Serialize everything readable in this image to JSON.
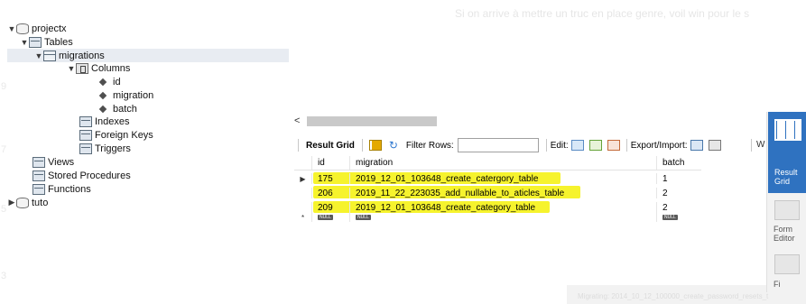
{
  "background": {
    "top_text": "Si on arrive à mettre un truc en place genre, voil win pour le s",
    "gutter_numbers": [
      "9",
      "7",
      "5",
      "3"
    ],
    "bottom_strip_text": "Migrating: 2014_10_12_100000_create_password_resets_t"
  },
  "navigator": {
    "items": [
      {
        "label": "projectx",
        "icon": "database-icon",
        "arrow": "▼"
      },
      {
        "label": "Tables",
        "icon": "folder-icon",
        "arrow": "▼"
      },
      {
        "label": "migrations",
        "icon": "table-icon",
        "arrow": "▼"
      },
      {
        "label": "Columns",
        "icon": "columns-icon",
        "arrow": "▼"
      },
      {
        "label": "id",
        "icon": "column-diamond-icon"
      },
      {
        "label": "migration",
        "icon": "column-diamond-icon"
      },
      {
        "label": "batch",
        "icon": "column-diamond-icon"
      },
      {
        "label": "Indexes",
        "icon": "folder-icon"
      },
      {
        "label": "Foreign Keys",
        "icon": "folder-icon"
      },
      {
        "label": "Triggers",
        "icon": "folder-icon"
      },
      {
        "label": "Views",
        "icon": "folder-icon"
      },
      {
        "label": "Stored Procedures",
        "icon": "folder-icon"
      },
      {
        "label": "Functions",
        "icon": "folder-icon"
      },
      {
        "label": "tuto",
        "icon": "database-icon",
        "arrow": "▶"
      }
    ]
  },
  "scroll": {
    "left_arrow": "<"
  },
  "toolbar": {
    "result_grid": "Result Grid",
    "filter_rows": "Filter Rows:",
    "edit": "Edit:",
    "export_import": "Export/Import:",
    "wrap": "W"
  },
  "grid": {
    "columns": [
      "id",
      "migration",
      "batch"
    ],
    "rows": [
      {
        "marker": "▶",
        "id": "175",
        "migration": "2019_12_01_103648_create_catergory_table",
        "batch": "1"
      },
      {
        "marker": "",
        "id": "206",
        "migration": "2019_11_22_223035_add_nullable_to_aticles_table",
        "batch": "2"
      },
      {
        "marker": "",
        "id": "209",
        "migration": "2019_12_01_103648_create_category_table",
        "batch": "2"
      }
    ],
    "new_row": {
      "marker": "*",
      "null": "NULL"
    },
    "highlight_color": "#f5f216"
  },
  "side_panel": {
    "result_grid_label_1": "Result",
    "result_grid_label_2": "Grid",
    "form_editor_label_1": "Form",
    "form_editor_label_2": "Editor",
    "field_types_label": "Fi",
    "accent": "#2f72c0"
  }
}
